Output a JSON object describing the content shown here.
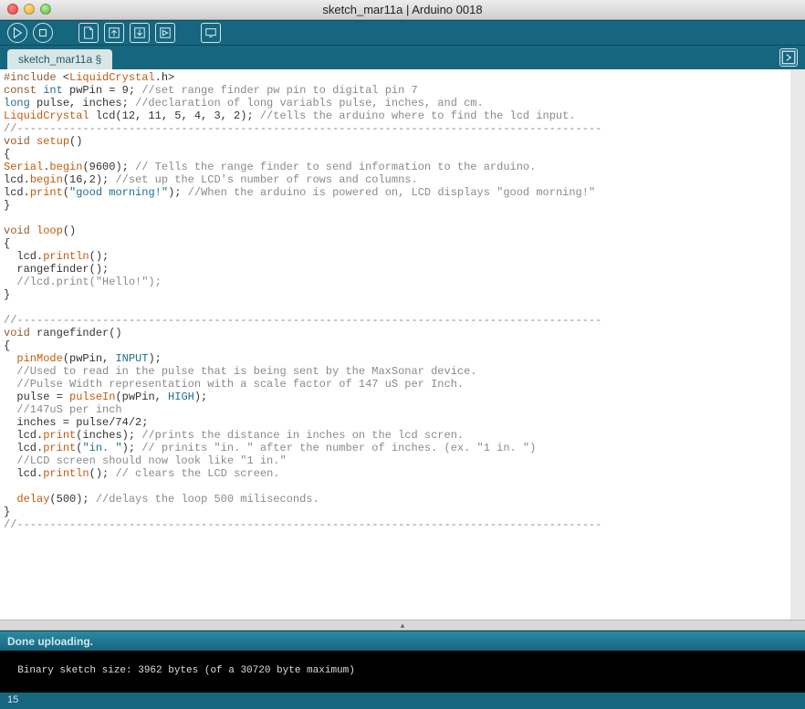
{
  "window": {
    "title": "sketch_mar11a | Arduino 0018"
  },
  "toolbar": {
    "run": "Verify",
    "stop": "Stop",
    "new_": "New",
    "open": "Open",
    "save": "Save",
    "upload": "Upload",
    "serial": "Serial Monitor"
  },
  "tabs": {
    "items": [
      {
        "label": "sketch_mar11a §"
      }
    ],
    "right_menu": "Tab menu"
  },
  "editor": {
    "code_html": "<span class=\"kw-pre\">#include</span> &lt;<span class=\"kw-api\">LiquidCrystal</span>.h&gt;\n<span class=\"kw-pre\">const</span> <span class=\"kw-type\">int</span> pwPin = 9; <span class=\"comment\">//set range finder pw pin to digital pin 7</span>\n<span class=\"kw-type\">long</span> pulse, inches; <span class=\"comment\">//declaration of long variabls pulse, inches, and cm.</span>\n<span class=\"kw-api\">LiquidCrystal</span> lcd(12, 11, 5, 4, 3, 2); <span class=\"comment\">//tells the arduino where to find the lcd input.</span>\n<span class=\"comment\">//-----------------------------------------------------------------------------------------</span>\n<span class=\"kw-pre\">void</span> <span class=\"kw-api\">setup</span>()\n{\n<span class=\"kw-api\">Serial</span>.<span class=\"kw-api\">begin</span>(9600); <span class=\"comment\">// Tells the range finder to send information to the arduino.</span>\nlcd.<span class=\"kw-api\">begin</span>(16,2); <span class=\"comment\">//set up the LCD's number of rows and columns.</span>\nlcd.<span class=\"kw-api\">print</span>(<span class=\"str\">\"good morning!\"</span>); <span class=\"comment\">//When the arduino is powered on, LCD displays \"good morning!\"</span>\n}\n\n<span class=\"kw-pre\">void</span> <span class=\"kw-api\">loop</span>()\n{\n  lcd.<span class=\"kw-api\">println</span>();\n  rangefinder();\n  <span class=\"comment\">//lcd.print(\"Hello!\");</span>\n}\n\n<span class=\"comment\">//-----------------------------------------------------------------------------------------</span>\n<span class=\"kw-pre\">void</span> rangefinder()\n{\n  <span class=\"kw-api\">pinMode</span>(pwPin, <span class=\"kw-const\">INPUT</span>);\n  <span class=\"comment\">//Used to read in the pulse that is being sent by the MaxSonar device.</span>\n  <span class=\"comment\">//Pulse Width representation with a scale factor of 147 uS per Inch.</span>\n  pulse = <span class=\"kw-api\">pulseIn</span>(pwPin, <span class=\"kw-const\">HIGH</span>);\n  <span class=\"comment\">//147uS per inch</span>\n  inches = pulse/74/2;\n  lcd.<span class=\"kw-api\">print</span>(inches); <span class=\"comment\">//prints the distance in inches on the lcd scren.</span>\n  lcd.<span class=\"kw-api\">print</span>(<span class=\"str\">\"in. \"</span>); <span class=\"comment\">// prinits \"in. \" after the number of inches. (ex. \"1 in. \")</span>\n  <span class=\"comment\">//LCD screen should now look like \"1 in.\"</span>\n  lcd.<span class=\"kw-api\">println</span>(); <span class=\"comment\">// clears the LCD screen.</span>\n\n  <span class=\"kw-api\">delay</span>(500); <span class=\"comment\">//delays the loop 500 miliseconds.</span>\n}\n<span class=\"comment\">//-----------------------------------------------------------------------------------------</span>"
  },
  "status": {
    "message": "Done uploading."
  },
  "console": {
    "text": "Binary sketch size: 3962 bytes (of a 30720 byte maximum)"
  },
  "bottom": {
    "line_number": "15"
  }
}
